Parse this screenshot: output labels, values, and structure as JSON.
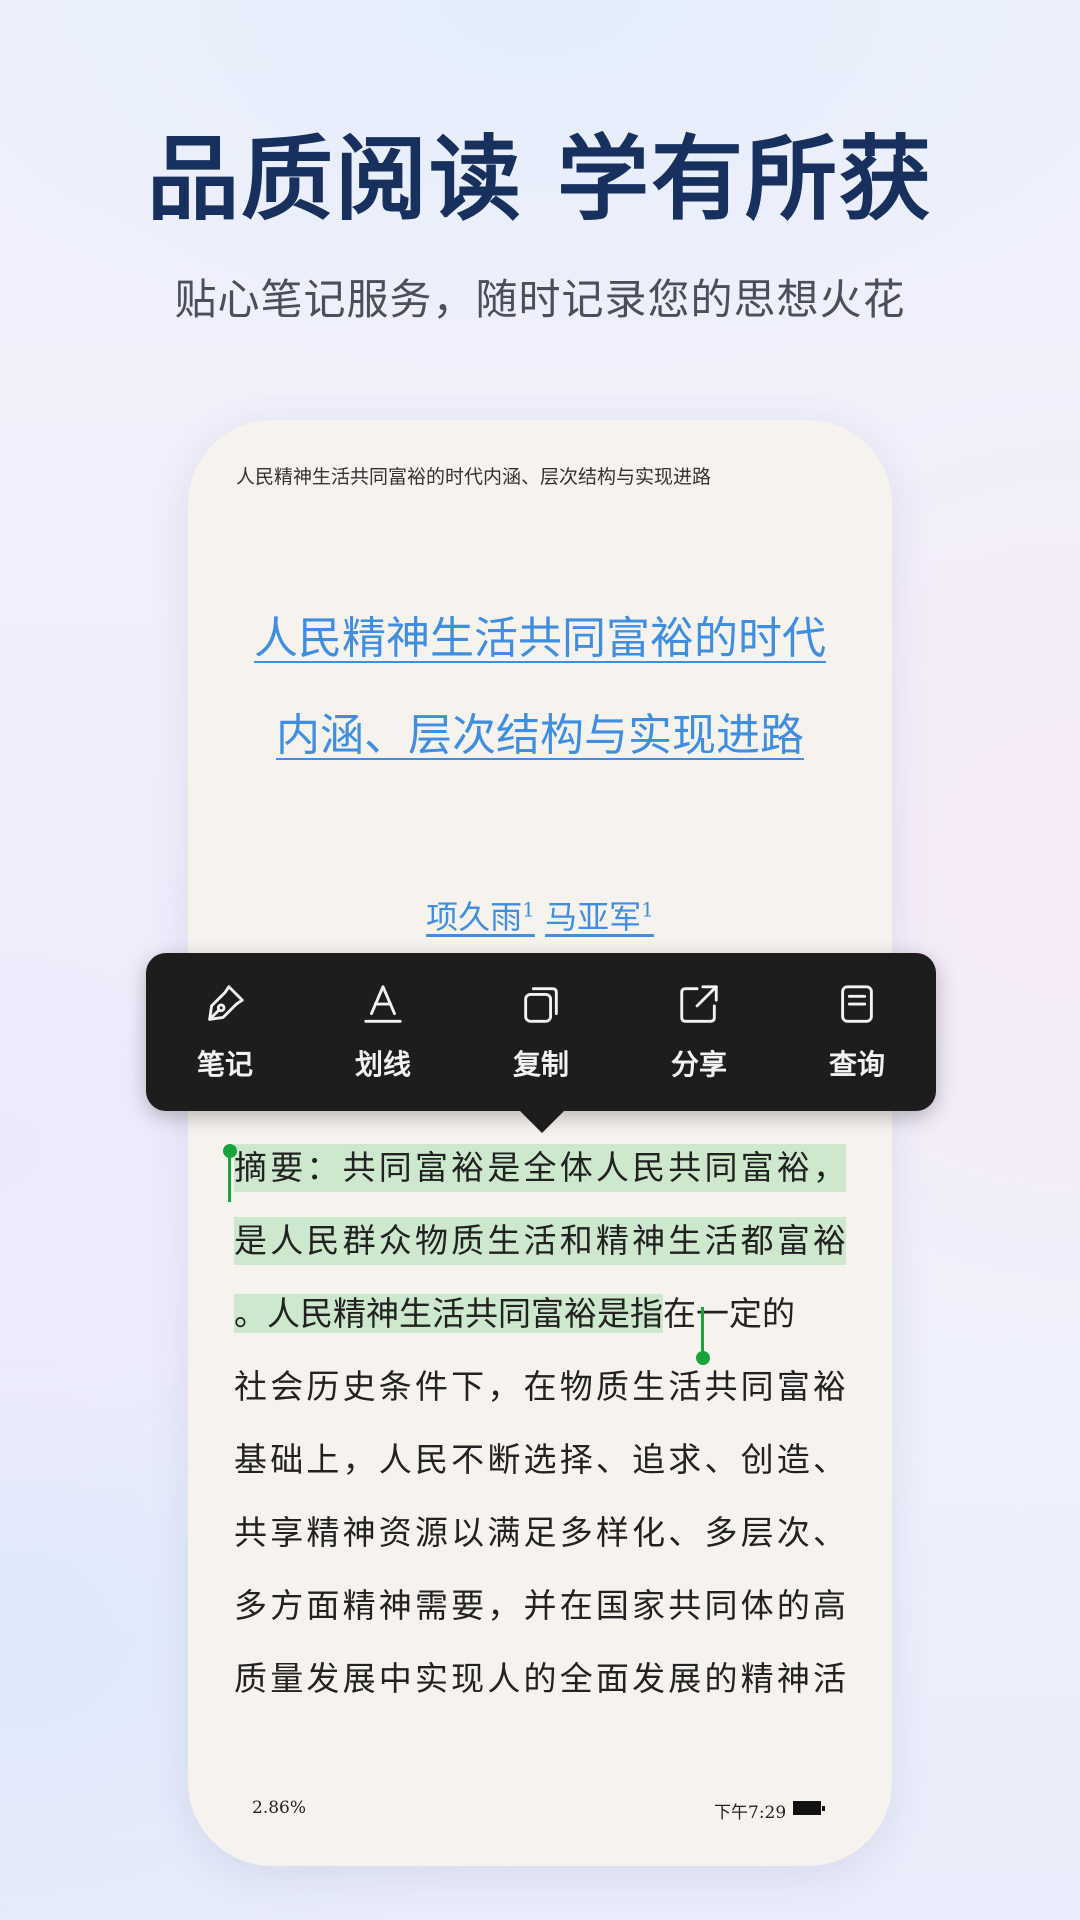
{
  "hero": {
    "headline": "品质阅读 学有所获",
    "subline": "贴心笔记服务，随时记录您的思想火花"
  },
  "reader": {
    "running_head": "人民精神生活共同富裕的时代内涵、层次结构与实现进路",
    "title_lines": [
      "人民精神生活共同富裕的时代",
      "内涵、层次结构与实现进路"
    ],
    "authors": [
      {
        "name": "项久雨",
        "sup": "1"
      },
      {
        "name": "马亚军",
        "sup": "1"
      }
    ],
    "body": {
      "line1": "摘要：共同富裕是全体人民共同富裕，",
      "line2": "是人民群众物质生活和精神生活都富裕",
      "line3_selected": "。人民精神生活共同富裕是指",
      "line3_rest": "在一定的",
      "line4": "社会历史条件下，在物质生活共同富裕",
      "line5": "基础上，人民不断选择、追求、创造、",
      "line6": "共享精神资源以满足多样化、多层次、",
      "line7": "多方面精神需要，并在国家共同体的高",
      "line8": "质量发展中实现人的全面发展的精神活"
    },
    "footer": {
      "progress": "2.86%",
      "time": "下午7:29"
    }
  },
  "toolbar": {
    "note": "笔记",
    "underline": "划线",
    "copy": "复制",
    "share": "分享",
    "lookup": "查询"
  },
  "colors": {
    "headline": "#17305e",
    "link_blue": "#3f8ee0",
    "highlight": "#cde8cd",
    "cursor_green": "#1aa33b",
    "toolbar_bg": "#1d1d1d"
  }
}
